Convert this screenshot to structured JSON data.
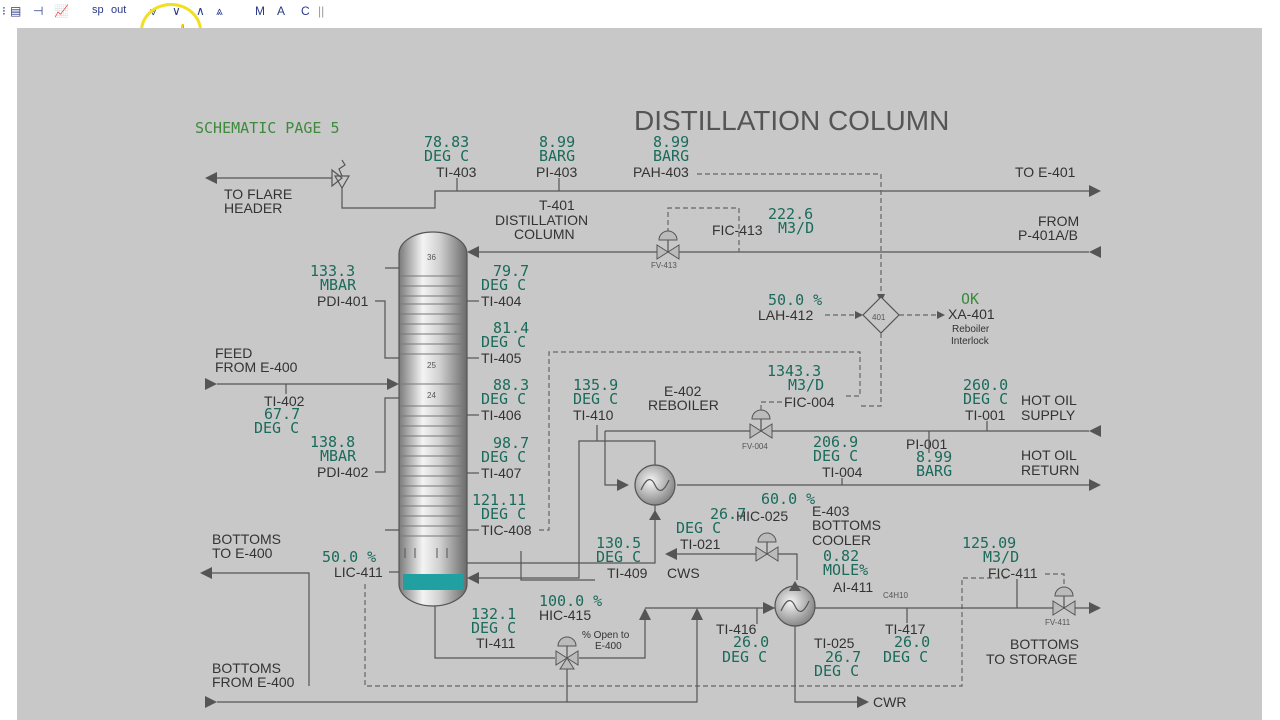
{
  "toolbar": {
    "sp": "sp",
    "out": "out",
    "m": "M",
    "a": "A",
    "c": "C"
  },
  "title": "DISTILLATION COLUMN",
  "schematic_page": "SCHEMATIC PAGE 5",
  "column": {
    "tag": "T-401",
    "name1": "DISTILLATION",
    "name2": "COLUMN",
    "tray_top": "36",
    "tray_mid": "25",
    "tray_low": "24"
  },
  "labels": {
    "to_flare1": "TO FLARE",
    "to_flare2": "HEADER",
    "to_e401": "TO E-401",
    "from1": "FROM",
    "from2": "P-401A/B",
    "feed1": "FEED",
    "feed2": "FROM E-400",
    "bottoms_to1": "BOTTOMS",
    "bottoms_to2": "TO E-400",
    "bottoms_from1": "BOTTOMS",
    "bottoms_from2": "FROM E-400",
    "e402a": "E-402",
    "e402b": "REBOILER",
    "e403a": "E-403",
    "e403b": "BOTTOMS",
    "e403c": "COOLER",
    "hot_oil_supply1": "HOT OIL",
    "hot_oil_supply2": "SUPPLY",
    "hot_oil_return1": "HOT OIL",
    "hot_oil_return2": "RETURN",
    "cws": "CWS",
    "cwr": "CWR",
    "bottoms_storage1": "BOTTOMS",
    "bottoms_storage2": "TO STORAGE",
    "reboiler_interlock1": "Reboiler",
    "reboiler_interlock2": "Interlock",
    "open_to1": "% Open to",
    "open_to2": "E-400",
    "c4h10": "C4H10",
    "fv413": "FV-413",
    "fv004": "FV-004",
    "fv411": "FV-411",
    "diamond": "401"
  },
  "instruments": {
    "ti403": {
      "value": "78.83",
      "unit": "DEG C",
      "tag": "TI-403"
    },
    "pi403": {
      "value": "8.99",
      "unit": "BARG",
      "tag": "PI-403"
    },
    "pah403": {
      "value": "8.99",
      "unit": "BARG",
      "tag": "PAH-403"
    },
    "fic413": {
      "value": "222.6",
      "unit": "M3/D",
      "tag": "FIC-413"
    },
    "pdi401": {
      "value": "133.3",
      "unit": "MBAR",
      "tag": "PDI-401"
    },
    "ti404": {
      "value": "79.7",
      "unit": "DEG C",
      "tag": "TI-404"
    },
    "ti405": {
      "value": "81.4",
      "unit": "DEG C",
      "tag": "TI-405"
    },
    "ti406": {
      "value": "88.3",
      "unit": "DEG C",
      "tag": "TI-406"
    },
    "ti407": {
      "value": "98.7",
      "unit": "DEG C",
      "tag": "TI-407"
    },
    "tic408": {
      "value": "121.11",
      "unit": "DEG C",
      "tag": "TIC-408"
    },
    "ti402": {
      "value": "67.7",
      "unit": "DEG C",
      "tag": "TI-402"
    },
    "pdi402": {
      "value": "138.8",
      "unit": "MBAR",
      "tag": "PDI-402"
    },
    "lic411": {
      "value": "50.0 %",
      "tag": "LIC-411"
    },
    "lah412": {
      "value": "50.0 %",
      "tag": "LAH-412"
    },
    "xa401": {
      "value": "OK",
      "tag": "XA-401"
    },
    "ti410": {
      "value": "135.9",
      "unit": "DEG C",
      "tag": "TI-410"
    },
    "fic004": {
      "value": "1343.3",
      "unit": "M3/D",
      "tag": "FIC-004"
    },
    "ti001": {
      "value": "260.0",
      "unit": "DEG C",
      "tag": "TI-001"
    },
    "ti004": {
      "value": "206.9",
      "unit": "DEG C",
      "tag": "TI-004"
    },
    "pi001": {
      "value": "8.99",
      "unit": "BARG",
      "tag": "PI-001"
    },
    "hic025": {
      "value": "60.0 %",
      "tag": "HIC-025"
    },
    "ti021": {
      "value": "26.7",
      "unit": "DEG C",
      "tag": "TI-021"
    },
    "ai411": {
      "value": "0.82",
      "unit": "MOLE%",
      "tag": "AI-411"
    },
    "fic411": {
      "value": "125.09",
      "unit": "M3/D",
      "tag": "FIC-411"
    },
    "ti409": {
      "value": "130.5",
      "unit": "DEG C",
      "tag": "TI-409"
    },
    "hic415": {
      "value": "100.0 %",
      "tag": "HIC-415"
    },
    "ti411": {
      "value": "132.1",
      "unit": "DEG C",
      "tag": "TI-411"
    },
    "ti416": {
      "value": "26.0",
      "unit": "DEG C",
      "tag": "TI-416"
    },
    "ti025": {
      "value": "26.7",
      "unit": "DEG C",
      "tag": "TI-025"
    },
    "ti417": {
      "value": "26.0",
      "unit": "DEG C",
      "tag": "TI-417"
    }
  },
  "colors": {
    "background": "#c8c8c8",
    "value_text": "#1a6b5b",
    "level": "#20a0a0"
  }
}
